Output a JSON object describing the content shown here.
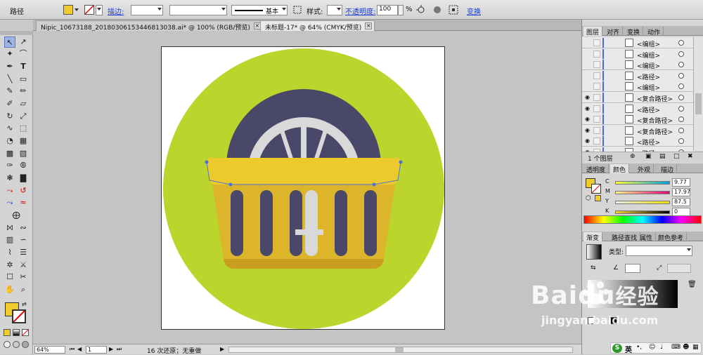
{
  "control_bar": {
    "object_type": "路径",
    "stroke_label": "描边:",
    "stroke_profile": "基本",
    "style_label": "样式:",
    "opacity_label": "不透明度:",
    "opacity_value": "100",
    "opacity_unit": "%",
    "transform_label": "变换",
    "fill_color": "#f0cb2e"
  },
  "doc_tabs": [
    {
      "label": "Nipic_10673188_20180306153446813038.ai* @ 100% (RGB/预览)",
      "close": "×"
    },
    {
      "label": "未标题-17* @ 64% (CMYK/预览)",
      "close": "×"
    }
  ],
  "layers_panel": {
    "tabs": [
      "图层",
      "对齐",
      "变换",
      "动作"
    ],
    "rows": [
      {
        "name": "<编组>",
        "visible": false
      },
      {
        "name": "<编组>",
        "visible": false
      },
      {
        "name": "<编组>",
        "visible": false
      },
      {
        "name": "<路径>",
        "visible": false
      },
      {
        "name": "<编组>",
        "visible": false
      },
      {
        "name": "<复合路径>",
        "visible": true
      },
      {
        "name": "<路径>",
        "visible": true
      },
      {
        "name": "<复合路径>",
        "visible": true
      },
      {
        "name": "<复合路径>",
        "visible": true
      },
      {
        "name": "<路径>",
        "visible": true
      },
      {
        "name": "<路径>",
        "visible": true
      }
    ],
    "footer": "1 个图层"
  },
  "color_panel": {
    "tabs": [
      "透明度",
      "颜色",
      "外观",
      "描边"
    ],
    "channels": [
      {
        "label": "C",
        "value": "9.77"
      },
      {
        "label": "M",
        "value": "17.97"
      },
      {
        "label": "Y",
        "value": "87.5"
      },
      {
        "label": "K",
        "value": "0"
      }
    ]
  },
  "gradient_panel": {
    "tabs": [
      "渐变",
      "路径查找",
      "属性",
      "颜色参考"
    ],
    "type_label": "类型:"
  },
  "status_bar": {
    "zoom": "64%",
    "page": "1",
    "history": "16 次还原；无重做"
  },
  "watermark": {
    "brand": "Baidu",
    "brand_cn": "经验",
    "url": "jingyan.baidu.com"
  },
  "ime": {
    "lang": "英"
  },
  "colors": {
    "circle": "#bcd52d",
    "tire": "#4a4869",
    "rim": "#d9d9d9",
    "basket": "#dcb52a",
    "basket_rim": "#ecca2c",
    "basket_shadow": "#c99d22"
  }
}
